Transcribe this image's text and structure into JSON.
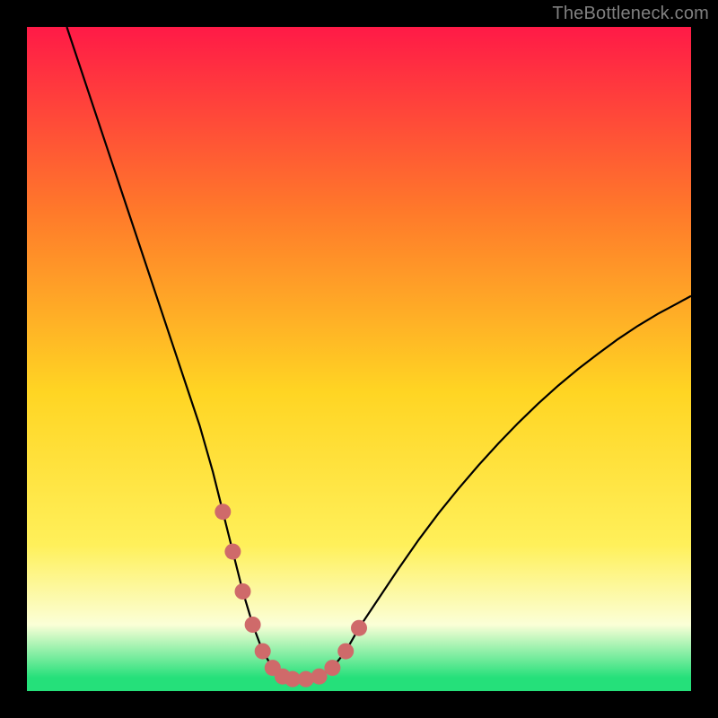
{
  "watermark": "TheBottleneck.com",
  "colors": {
    "bg": "#000000",
    "watermark": "#808080",
    "gradient_top": "#ff1a47",
    "gradient_mid_upper": "#ff7a2a",
    "gradient_mid": "#ffd523",
    "gradient_mid_lower": "#fff05a",
    "gradient_lower_pale": "#fbffd7",
    "gradient_green": "#25e07a",
    "curve_stroke": "#000000",
    "marker_fill": "#cf6a6a"
  },
  "chart_data": {
    "type": "line",
    "title": "",
    "xlabel": "",
    "ylabel": "",
    "xlim": [
      0,
      100
    ],
    "ylim": [
      0,
      100
    ],
    "series": [
      {
        "name": "curve",
        "x": [
          6,
          8,
          10,
          12,
          14,
          16,
          18,
          20,
          22,
          24,
          26,
          28,
          29.5,
          31,
          32.5,
          34,
          35.5,
          37,
          38.5,
          40,
          42,
          44,
          46,
          48,
          50,
          53,
          56,
          59,
          62,
          65,
          68,
          71,
          74,
          77,
          80,
          83,
          86,
          89,
          92,
          95,
          98,
          100
        ],
        "y": [
          100,
          94,
          88,
          82,
          76,
          70,
          64,
          58,
          52,
          46,
          40,
          33,
          27,
          21,
          15,
          10,
          6,
          3.5,
          2.2,
          1.8,
          1.8,
          2.2,
          3.5,
          6,
          9.5,
          14,
          18.5,
          22.8,
          26.8,
          30.5,
          34,
          37.3,
          40.4,
          43.3,
          46,
          48.5,
          50.8,
          53,
          55,
          56.8,
          58.4,
          59.5
        ]
      }
    ],
    "markers": {
      "name": "highlight-dots",
      "x": [
        29.5,
        31,
        32.5,
        34,
        35.5,
        37,
        38.5,
        40,
        42,
        44,
        46,
        48,
        50
      ],
      "y": [
        27,
        21,
        15,
        10,
        6,
        3.5,
        2.2,
        1.8,
        1.8,
        2.2,
        3.5,
        6,
        9.5
      ]
    }
  }
}
